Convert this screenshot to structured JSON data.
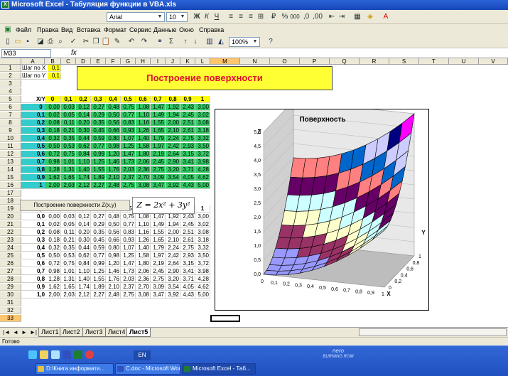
{
  "window": {
    "title": "Microsoft Excel - Табуляция функции в VBA.xls",
    "app_icon": "excel-icon"
  },
  "format_toolbar": {
    "font": "Arial",
    "size": "10",
    "zoom": "100%"
  },
  "menu": [
    "Файл",
    "Правка",
    "Вид",
    "Вставка",
    "Формат",
    "Сервис",
    "Данные",
    "Окно",
    "Справка"
  ],
  "formula_bar": {
    "name_box": "M33",
    "fx": "fx",
    "value": ""
  },
  "columns": [
    "A",
    "B",
    "C",
    "D",
    "E",
    "F",
    "G",
    "H",
    "I",
    "J",
    "K",
    "L",
    "M",
    "N",
    "O",
    "P",
    "Q",
    "R",
    "S",
    "T",
    "U",
    "V"
  ],
  "rows": [
    "1",
    "2",
    "3",
    "4",
    "5",
    "6",
    "7",
    "8",
    "9",
    "10",
    "11",
    "12",
    "13",
    "14",
    "15",
    "16",
    "17",
    "18",
    "19",
    "20",
    "21",
    "22",
    "23",
    "24",
    "25",
    "26",
    "27",
    "28",
    "29",
    "30",
    "31",
    "32",
    "33"
  ],
  "params": {
    "step_x_label": "Шаг по X =",
    "step_x": "0,1",
    "step_y_label": "Шаг по Y =",
    "step_y": "0,1"
  },
  "banner": "Построение поверхности",
  "table1": {
    "corner": "X/Y",
    "headers": [
      "0",
      "0,1",
      "0,2",
      "0,3",
      "0,4",
      "0,5",
      "0,6",
      "0,7",
      "0,8",
      "0,9",
      "1"
    ],
    "row_labels": [
      "0",
      "0,1",
      "0,2",
      "0,3",
      "0,4",
      "0,5",
      "0,6",
      "0,7",
      "0,8",
      "0,9",
      "1"
    ],
    "cells": [
      [
        "0,00",
        "0,03",
        "0,12",
        "0,27",
        "0,48",
        "0,75",
        "1,08",
        "1,47",
        "1,92",
        "2,43",
        "3,00"
      ],
      [
        "0,02",
        "0,05",
        "0,14",
        "0,29",
        "0,50",
        "0,77",
        "1,10",
        "1,49",
        "1,94",
        "2,45",
        "3,02"
      ],
      [
        "0,08",
        "0,11",
        "0,20",
        "0,35",
        "0,56",
        "0,83",
        "1,16",
        "1,55",
        "2,00",
        "2,51",
        "3,08"
      ],
      [
        "0,18",
        "0,21",
        "0,30",
        "0,45",
        "0,66",
        "0,93",
        "1,26",
        "1,65",
        "2,10",
        "2,61",
        "3,18"
      ],
      [
        "0,32",
        "0,35",
        "0,44",
        "0,59",
        "0,80",
        "1,07",
        "1,40",
        "1,79",
        "2,24",
        "2,75",
        "3,32"
      ],
      [
        "0,50",
        "0,53",
        "0,62",
        "0,77",
        "0,98",
        "1,25",
        "1,58",
        "1,97",
        "2,42",
        "2,93",
        "3,50"
      ],
      [
        "0,72",
        "0,75",
        "0,84",
        "0,99",
        "1,20",
        "1,47",
        "1,80",
        "2,19",
        "2,64",
        "3,15",
        "3,72"
      ],
      [
        "0,98",
        "1,01",
        "1,10",
        "1,25",
        "1,46",
        "1,73",
        "2,06",
        "2,45",
        "2,90",
        "3,41",
        "3,98"
      ],
      [
        "1,28",
        "1,31",
        "1,40",
        "1,55",
        "1,76",
        "2,03",
        "2,36",
        "2,75",
        "3,20",
        "3,71",
        "4,28"
      ],
      [
        "1,62",
        "1,65",
        "1,74",
        "1,89",
        "2,10",
        "2,37",
        "2,70",
        "3,09",
        "3,54",
        "4,05",
        "4,62"
      ],
      [
        "2,00",
        "2,03",
        "2,12",
        "2,27",
        "2,48",
        "2,75",
        "3,08",
        "3,47",
        "3,92",
        "4,43",
        "5,00"
      ]
    ]
  },
  "table2": {
    "corner": "X/Y (vba)",
    "headers": [
      "0",
      "0,1",
      "0,2",
      "0,3",
      "0,4",
      "0,5",
      "0,6",
      "0,7",
      "0,8",
      "0,9",
      "1"
    ],
    "row_labels": [
      "0,0",
      "0,1",
      "0,2",
      "0,3",
      "0,4",
      "0,5",
      "0,6",
      "0,7",
      "0,8",
      "0,9",
      "1,0"
    ],
    "cells": [
      [
        "0,00",
        "0,03",
        "0,12",
        "0,27",
        "0,48",
        "0,75",
        "1,08",
        "1,47",
        "1,92",
        "2,43",
        "3,00"
      ],
      [
        "0,02",
        "0,05",
        "0,14",
        "0,29",
        "0,50",
        "0,77",
        "1,10",
        "1,49",
        "1,94",
        "2,45",
        "3,02"
      ],
      [
        "0,08",
        "0,11",
        "0,20",
        "0,35",
        "0,56",
        "0,83",
        "1,16",
        "1,55",
        "2,00",
        "2,51",
        "3,08"
      ],
      [
        "0,18",
        "0,21",
        "0,30",
        "0,45",
        "0,66",
        "0,93",
        "1,26",
        "1,65",
        "2,10",
        "2,61",
        "3,18"
      ],
      [
        "0,32",
        "0,35",
        "0,44",
        "0,59",
        "0,80",
        "1,07",
        "1,40",
        "1,79",
        "2,24",
        "2,75",
        "3,32"
      ],
      [
        "0,50",
        "0,53",
        "0,62",
        "0,77",
        "0,98",
        "1,25",
        "1,58",
        "1,97",
        "2,42",
        "2,93",
        "3,50"
      ],
      [
        "0,72",
        "0,75",
        "0,84",
        "0,99",
        "1,20",
        "1,47",
        "1,80",
        "2,19",
        "2,64",
        "3,15",
        "3,72"
      ],
      [
        "0,98",
        "1,01",
        "1,10",
        "1,25",
        "1,46",
        "1,73",
        "2,06",
        "2,45",
        "2,90",
        "3,41",
        "3,98"
      ],
      [
        "1,28",
        "1,31",
        "1,40",
        "1,55",
        "1,76",
        "2,03",
        "2,36",
        "2,75",
        "3,20",
        "3,71",
        "4,28"
      ],
      [
        "1,62",
        "1,65",
        "1,74",
        "1,89",
        "2,10",
        "2,37",
        "2,70",
        "3,09",
        "3,54",
        "4,05",
        "4,62"
      ],
      [
        "2,00",
        "2,03",
        "2,12",
        "2,27",
        "2,48",
        "2,75",
        "3,08",
        "3,47",
        "3,92",
        "4,43",
        "5,00"
      ]
    ]
  },
  "macro_button": "Построение поверхности Z(x,y)",
  "formula_text": "Z = 2x² + 3y²",
  "colors": {
    "header_yellow": "#ffff00",
    "label_teal": "#33cccc",
    "data_green": "#33cc66",
    "banner_text": "#e0102c"
  },
  "chart_data": {
    "type": "surface",
    "title": "Поверхность",
    "zlabel": "Z",
    "xlabel": "X",
    "ylabel": "Y",
    "z_ticks": [
      "0,0",
      "0,5",
      "1,0",
      "1,5",
      "2,0",
      "2,5",
      "3,0",
      "3,5",
      "4,0",
      "4,5",
      "5,0"
    ],
    "x_ticks": [
      "0",
      "0,1",
      "0,2",
      "0,3",
      "0,4",
      "0,5",
      "0,6",
      "0,7",
      "0,8",
      "0,9",
      "1"
    ],
    "y_ticks": [
      "0",
      "0,2",
      "0,4",
      "0,6",
      "0,8",
      "1"
    ],
    "zlim": [
      0,
      5
    ],
    "bands": [
      {
        "range": [
          0,
          0.5
        ],
        "color": "#9999ff"
      },
      {
        "range": [
          0.5,
          1.0
        ],
        "color": "#993366"
      },
      {
        "range": [
          1.0,
          1.5
        ],
        "color": "#ffffcc"
      },
      {
        "range": [
          1.5,
          2.0
        ],
        "color": "#ccffff"
      },
      {
        "range": [
          2.0,
          2.5
        ],
        "color": "#660066"
      },
      {
        "range": [
          2.5,
          3.0
        ],
        "color": "#ff8080"
      },
      {
        "range": [
          3.0,
          3.5
        ],
        "color": "#0066cc"
      },
      {
        "range": [
          3.5,
          4.0
        ],
        "color": "#ccccff"
      },
      {
        "range": [
          4.0,
          4.5
        ],
        "color": "#000080"
      },
      {
        "range": [
          4.5,
          5.0
        ],
        "color": "#ff00ff"
      }
    ]
  },
  "sheets": [
    "Лист1",
    "Лист2",
    "Лист3",
    "Лист4",
    "Лист5"
  ],
  "active_sheet": "Лист5",
  "status": "Готово",
  "taskbar": {
    "lang": "EN",
    "nero": "nero",
    "nero_sub": "BURNING ROM",
    "tasks": [
      {
        "label": "D:\\Книга информати...",
        "icon_color": "#e8c040"
      },
      {
        "label": "C.doc - Microsoft Word",
        "icon_color": "#3050c0"
      },
      {
        "label": "Microsoft Excel - Таб...",
        "icon_color": "#1e7d32"
      }
    ]
  }
}
